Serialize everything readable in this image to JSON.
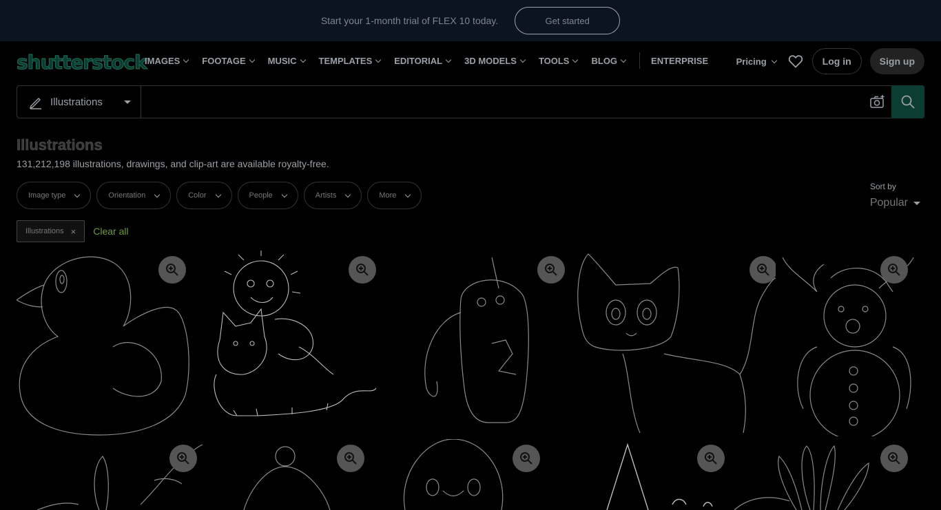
{
  "promo": {
    "text": "Start your 1-month trial of FLEX 10 today.",
    "button": "Get started"
  },
  "nav": {
    "logo": "shutterstock",
    "items": [
      "IMAGES",
      "FOOTAGE",
      "MUSIC",
      "TEMPLATES",
      "EDITORIAL",
      "3D MODELS",
      "TOOLS",
      "BLOG"
    ],
    "enterprise": "ENTERPRISE",
    "pricing": "Pricing",
    "login": "Log in",
    "signup": "Sign up"
  },
  "search": {
    "type": "Illustrations",
    "value": "",
    "placeholder": ""
  },
  "page": {
    "title": "Illustrations",
    "subtitle": "131,212,198 illustrations, drawings, and clip-art are available royalty-free."
  },
  "filters": [
    "Image type",
    "Orientation",
    "Color",
    "People",
    "Artists",
    "More"
  ],
  "sort": {
    "label": "Sort by",
    "value": "Popular"
  },
  "chips": {
    "active": "Illustrations",
    "clear": "Clear all"
  },
  "tiles": [
    {
      "subject": "rubber duck outline"
    },
    {
      "subject": "sun cat and dog doodle"
    },
    {
      "subject": "unicorn holding number 2"
    },
    {
      "subject": "cartoon cat outline"
    },
    {
      "subject": "reindeer snowman outline"
    },
    {
      "subject": "bird on branch outline"
    },
    {
      "subject": "winter hat outline"
    },
    {
      "subject": "penguin outline"
    },
    {
      "subject": "gnome hat outline"
    },
    {
      "subject": "flower outline"
    }
  ],
  "colors": {
    "promo_bg": "#0b1420",
    "brand": "#0c3d32",
    "link_green": "#6b9a3a",
    "line_art": "#8a8a8a"
  }
}
